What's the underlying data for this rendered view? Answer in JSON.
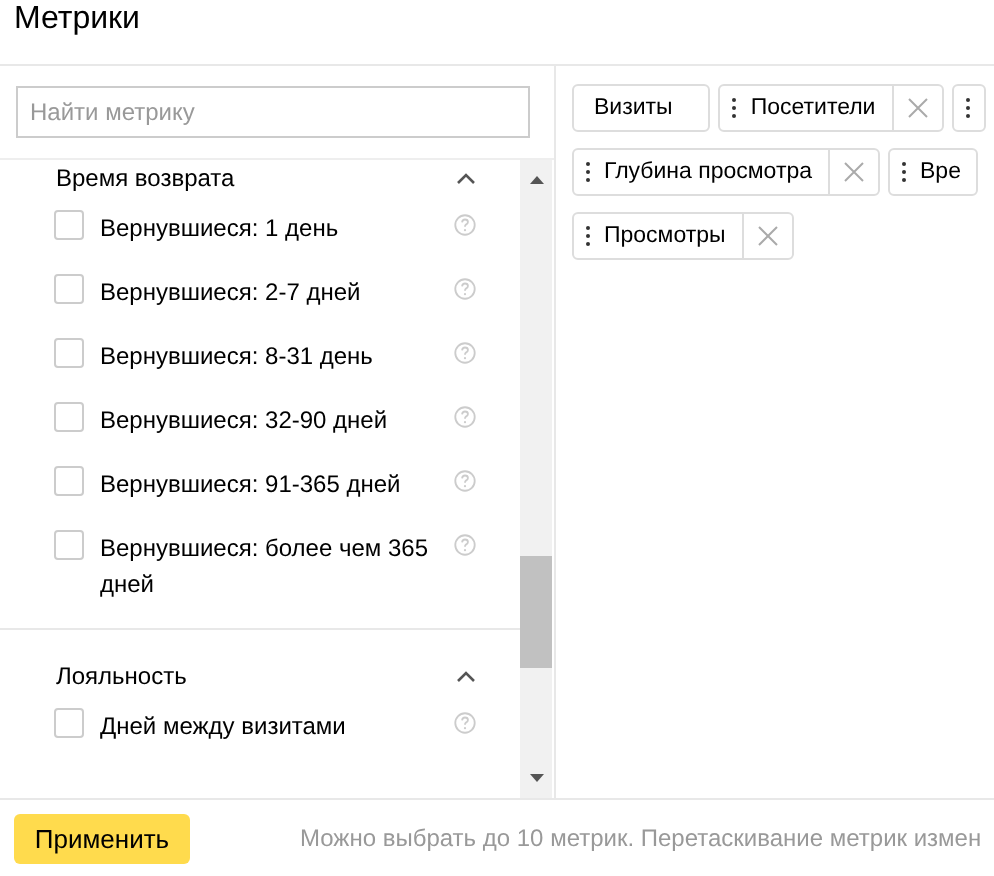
{
  "window": {
    "title": "Метрики"
  },
  "search": {
    "placeholder": "Найти метрику"
  },
  "groups": [
    {
      "title": "Время возврата",
      "expanded": true,
      "items": [
        {
          "label": "Вернувшиеся: 1 день",
          "checked": false
        },
        {
          "label": "Вернувшиеся: 2-7 дней",
          "checked": false
        },
        {
          "label": "Вернувшиеся: 8-31 день",
          "checked": false
        },
        {
          "label": "Вернувшиеся: 32-90 дней",
          "checked": false
        },
        {
          "label": "Вернувшиеся: 91-365 дней",
          "checked": false
        },
        {
          "label": "Вернувшиеся: более чем 365 дней",
          "checked": false
        }
      ]
    },
    {
      "title": "Лояльность",
      "expanded": true,
      "items": [
        {
          "label": "Дней между визитами",
          "checked": false
        }
      ]
    }
  ],
  "chip_rows": [
    [
      {
        "label": "Визиты",
        "draggable": false,
        "removable": false
      },
      {
        "label": "Посетители",
        "draggable": true,
        "removable": true
      },
      {
        "draggable": true,
        "removable": false
      }
    ],
    [
      {
        "label": "Глубина просмотра",
        "draggable": true,
        "removable": true
      },
      {
        "label": "Вре",
        "draggable": true,
        "removable": false
      }
    ],
    [
      {
        "label": "Просмотры",
        "draggable": true,
        "removable": true
      }
    ]
  ],
  "apply_button": "Применить",
  "hint": "Можно выбрать до 10 метрик. Перетаскивание метрик измен"
}
